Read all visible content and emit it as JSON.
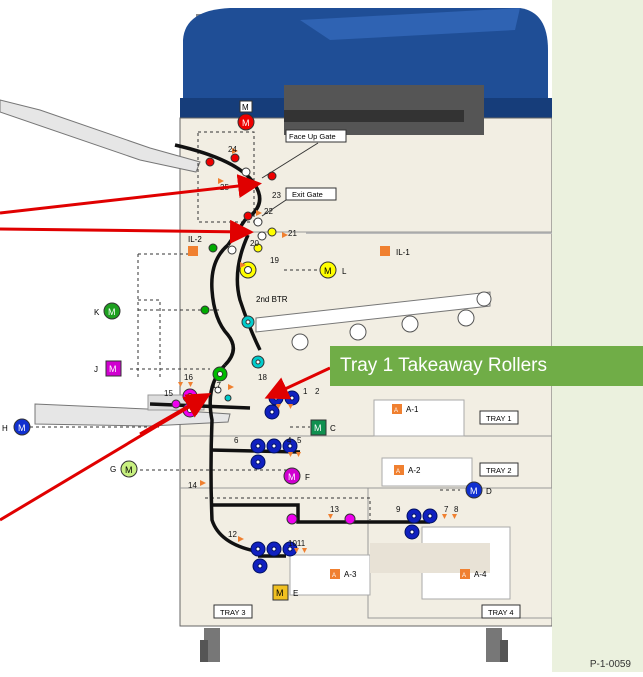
{
  "callout": {
    "text": "Tray 1 Takeaway Rollers",
    "color": "#70ad47"
  },
  "figure_id": "P-1-0059",
  "gates": {
    "face_up": "Face Up Gate",
    "exit": "Exit Gate"
  },
  "btr_label": "2nd BTR",
  "trays": {
    "tray1": "TRAY 1",
    "tray2": "TRAY 2",
    "tray3": "TRAY 3",
    "tray4": "TRAY 4"
  },
  "motors": {
    "top": "M",
    "k": "K",
    "j": "J",
    "h": "H",
    "g": "G",
    "l": "L",
    "c": "C",
    "f": "F",
    "d": "D",
    "e": "E"
  },
  "motor_letter": "M",
  "interlocks": {
    "il1": "IL-1",
    "il2": "IL-2"
  },
  "switches": {
    "a1": "A-1",
    "a2": "A-2",
    "a3": "A-3",
    "a4": "A-4",
    "a_letter": "A"
  },
  "sensor_numbers": {
    "n1": "1",
    "n2": "2",
    "n4": "4",
    "n5": "5",
    "n6": "6",
    "n7": "7",
    "n8": "8",
    "n9": "9",
    "n1011": "1011",
    "n12": "12",
    "n13": "13",
    "n14": "14",
    "n15": "15",
    "n16": "16",
    "n17": "17",
    "n18": "18",
    "n19": "19",
    "n20": "20",
    "n21": "21",
    "n22": "22",
    "n23": "23",
    "n24": "24",
    "n25": "25"
  },
  "colors": {
    "body_blue": "#1f4e96",
    "frame_beige": "#f2eee3",
    "arrow_red": "#e00000",
    "panel_green": "#ebf1de"
  }
}
